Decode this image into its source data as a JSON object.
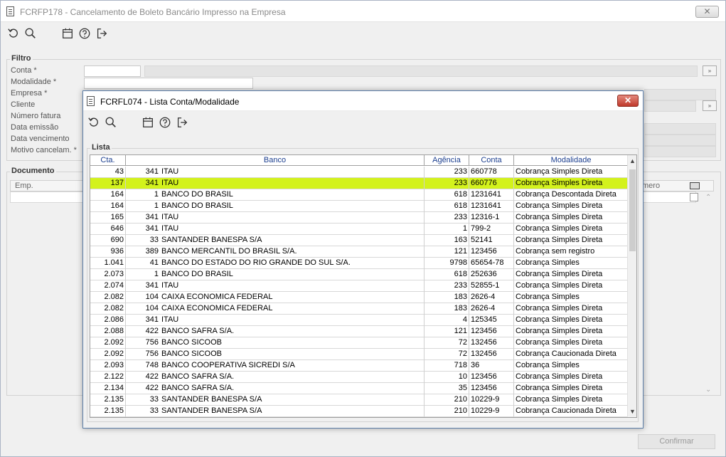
{
  "main": {
    "title": "FCRFP178 - Cancelamento de Boleto Bancário Impresso na Empresa",
    "close_label": "✕",
    "filtro": {
      "legend": "Filtro",
      "fields": [
        "Conta *",
        "Modalidade *",
        "Empresa *",
        "Cliente",
        "Número fatura",
        "Data emissão",
        "Data vencimento",
        "Motivo cancelam. *"
      ]
    },
    "documento": {
      "legend": "Documento",
      "col_emp": "Emp.",
      "col_numero": "mero"
    },
    "confirmar_label": "Confirmar"
  },
  "dialog": {
    "title": "FCRFL074 - Lista Conta/Modalidade",
    "lista_legend": "Lista",
    "headers": {
      "cta": "Cta.",
      "banco": "Banco",
      "agencia": "Agência",
      "conta": "Conta",
      "modalidade": "Modalidade"
    },
    "rows": [
      {
        "cta": "43",
        "bcode": "341",
        "bname": "ITAU",
        "ag": "233",
        "conta": "660778",
        "mod": "Cobrança Simples Direta",
        "sel": false
      },
      {
        "cta": "137",
        "bcode": "341",
        "bname": "ITAU",
        "ag": "233",
        "conta": "660776",
        "mod": "Cobrança Simples Direta",
        "sel": true
      },
      {
        "cta": "164",
        "bcode": "1",
        "bname": "BANCO DO BRASIL",
        "ag": "618",
        "conta": "1231641",
        "mod": "Cobrança Descontada Direta",
        "sel": false
      },
      {
        "cta": "164",
        "bcode": "1",
        "bname": "BANCO DO BRASIL",
        "ag": "618",
        "conta": "1231641",
        "mod": "Cobrança Simples Direta",
        "sel": false
      },
      {
        "cta": "165",
        "bcode": "341",
        "bname": "ITAU",
        "ag": "233",
        "conta": "12316-1",
        "mod": "Cobrança Simples Direta",
        "sel": false
      },
      {
        "cta": "646",
        "bcode": "341",
        "bname": "ITAU",
        "ag": "1",
        "conta": "799-2",
        "mod": "Cobrança Simples Direta",
        "sel": false
      },
      {
        "cta": "690",
        "bcode": "33",
        "bname": "SANTANDER BANESPA S/A",
        "ag": "163",
        "conta": "52141",
        "mod": "Cobrança Simples Direta",
        "sel": false
      },
      {
        "cta": "936",
        "bcode": "389",
        "bname": "BANCO MERCANTIL DO BRASIL S/A.",
        "ag": "121",
        "conta": "123456",
        "mod": "Cobrança sem registro",
        "sel": false
      },
      {
        "cta": "1.041",
        "bcode": "41",
        "bname": "BANCO DO ESTADO DO RIO GRANDE DO SUL S/A.",
        "ag": "9798",
        "conta": "65654-78",
        "mod": "Cobrança Simples",
        "sel": false
      },
      {
        "cta": "2.073",
        "bcode": "1",
        "bname": "BANCO DO BRASIL",
        "ag": "618",
        "conta": "252636",
        "mod": "Cobrança Simples Direta",
        "sel": false
      },
      {
        "cta": "2.074",
        "bcode": "341",
        "bname": "ITAU",
        "ag": "233",
        "conta": "52855-1",
        "mod": "Cobrança Simples Direta",
        "sel": false
      },
      {
        "cta": "2.082",
        "bcode": "104",
        "bname": "CAIXA ECONOMICA FEDERAL",
        "ag": "183",
        "conta": "2626-4",
        "mod": "Cobrança Simples",
        "sel": false
      },
      {
        "cta": "2.082",
        "bcode": "104",
        "bname": "CAIXA ECONOMICA FEDERAL",
        "ag": "183",
        "conta": "2626-4",
        "mod": "Cobrança Simples Direta",
        "sel": false
      },
      {
        "cta": "2.086",
        "bcode": "341",
        "bname": "ITAU",
        "ag": "4",
        "conta": "125345",
        "mod": "Cobrança Simples Direta",
        "sel": false
      },
      {
        "cta": "2.088",
        "bcode": "422",
        "bname": "BANCO SAFRA S/A.",
        "ag": "121",
        "conta": "123456",
        "mod": "Cobrança Simples Direta",
        "sel": false
      },
      {
        "cta": "2.092",
        "bcode": "756",
        "bname": "BANCO SICOOB",
        "ag": "72",
        "conta": "132456",
        "mod": "Cobrança Simples Direta",
        "sel": false
      },
      {
        "cta": "2.092",
        "bcode": "756",
        "bname": "BANCO SICOOB",
        "ag": "72",
        "conta": "132456",
        "mod": "Cobrança Caucionada Direta",
        "sel": false
      },
      {
        "cta": "2.093",
        "bcode": "748",
        "bname": "BANCO COOPERATIVA SICREDI S/A",
        "ag": "718",
        "conta": "36",
        "mod": "Cobrança Simples",
        "sel": false
      },
      {
        "cta": "2.122",
        "bcode": "422",
        "bname": "BANCO SAFRA S/A.",
        "ag": "10",
        "conta": "123456",
        "mod": "Cobrança Simples Direta",
        "sel": false
      },
      {
        "cta": "2.134",
        "bcode": "422",
        "bname": "BANCO SAFRA S/A.",
        "ag": "35",
        "conta": "123456",
        "mod": "Cobrança Simples Direta",
        "sel": false
      },
      {
        "cta": "2.135",
        "bcode": "33",
        "bname": "SANTANDER BANESPA S/A",
        "ag": "210",
        "conta": "10229-9",
        "mod": "Cobrança Simples Direta",
        "sel": false
      },
      {
        "cta": "2.135",
        "bcode": "33",
        "bname": "SANTANDER BANESPA S/A",
        "ag": "210",
        "conta": "10229-9",
        "mod": "Cobrança Caucionada Direta",
        "sel": false
      }
    ]
  },
  "toolbar_icons": [
    "refresh-icon",
    "search-icon",
    "calendar-icon",
    "help-icon",
    "exit-icon"
  ],
  "colors": {
    "selection": "#d3f21c",
    "header_text": "#1c3f8f",
    "dialog_close": "#c0392b"
  }
}
